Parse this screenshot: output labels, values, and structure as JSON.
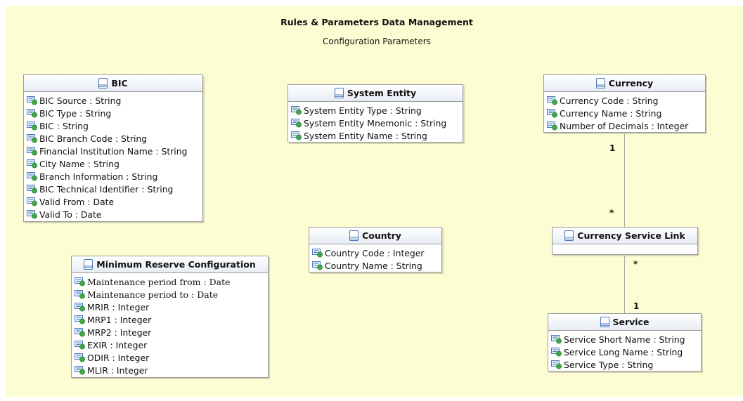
{
  "diagram": {
    "title": "Rules & Parameters Data Management",
    "subtitle": "Configuration Parameters"
  },
  "classes": {
    "bic": {
      "name": "BIC",
      "attributes": [
        "BIC Source : String",
        "BIC Type : String",
        "BIC : String",
        "BIC Branch Code : String",
        "Financial Institution Name : String",
        "City Name : String",
        "Branch Information : String",
        "BIC Technical Identifier : String",
        "Valid From : Date",
        "Valid To : Date"
      ]
    },
    "system_entity": {
      "name": "System Entity",
      "attributes": [
        "System Entity Type : String",
        "System Entity Mnemonic : String",
        "System Entity Name : String"
      ]
    },
    "currency": {
      "name": "Currency",
      "attributes": [
        "Currency Code : String",
        "Currency Name : String",
        "Number of Decimals : Integer"
      ]
    },
    "country": {
      "name": "Country",
      "attributes": [
        "Country Code : Integer",
        "Country Name : String"
      ]
    },
    "currency_service_link": {
      "name": "Currency Service Link",
      "attributes": []
    },
    "minimum_reserve": {
      "name": "Minimum Reserve Configuration",
      "attributes": [
        "Maintenance period from  : Date",
        "Maintenance period to : Date",
        "MRIR : Integer",
        "MRP1 : Integer",
        "MRP2 : Integer",
        "EXIR : Integer",
        "ODIR : Integer",
        "MLIR : Integer"
      ]
    },
    "service": {
      "name": "Service",
      "attributes": [
        "Service Short Name : String",
        "Service Long Name : String",
        "Service Type : String"
      ]
    }
  },
  "associations": [
    {
      "from": "Currency",
      "to": "Currency Service Link",
      "from_multiplicity": "1",
      "to_multiplicity": "*"
    },
    {
      "from": "Currency Service Link",
      "to": "Service",
      "from_multiplicity": "*",
      "to_multiplicity": "1"
    }
  ],
  "icons": {
    "class": "uml-class-icon",
    "attribute": "uml-attribute-icon"
  },
  "colors": {
    "canvas": "#fdfdd3",
    "box_border": "#9a9a9a",
    "connector": "#a8a8a8",
    "icon_blue": "#4a78b8",
    "icon_green": "#3ea84a"
  }
}
